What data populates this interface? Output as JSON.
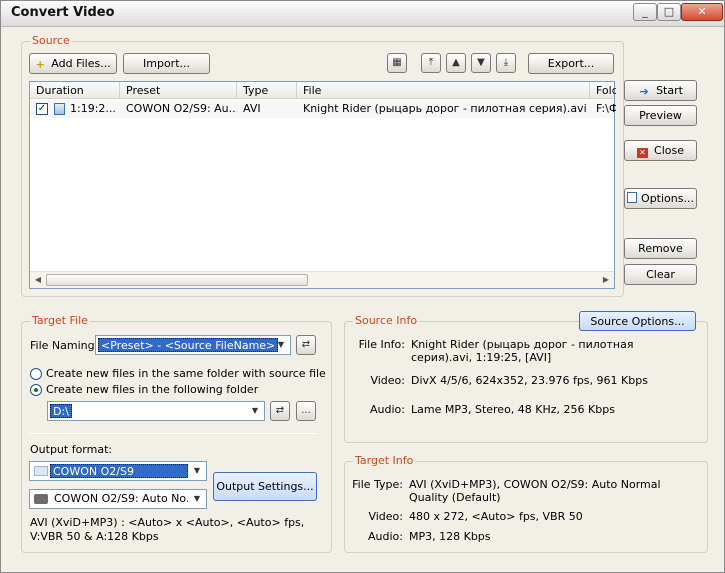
{
  "window": {
    "title": "Convert Video",
    "minimize": "_",
    "maximize": "□",
    "close": "✕"
  },
  "source": {
    "label": "Source",
    "add_files": "Add Files...",
    "import": "Import...",
    "export": "Export...",
    "columns": [
      "Duration",
      "Preset",
      "Type",
      "File",
      "Fold"
    ],
    "rows": [
      {
        "duration": "1:19:2...",
        "preset": "COWON O2/S9: Au...",
        "type": "AVI",
        "file": "Knight Rider (рыцарь дорог - пилотная серия).avi",
        "folder": "F:\\Ф"
      }
    ]
  },
  "side_buttons": {
    "start": "Start",
    "preview": "Preview",
    "close": "Close",
    "options": "Options...",
    "remove": "Remove",
    "clear": "Clear"
  },
  "target_file": {
    "label": "Target File",
    "naming_label": "File Naming:",
    "naming_value": "<Preset> - <Source FileName>",
    "radio_same": "Create new files in the same folder with source file",
    "radio_following": "Create new files in the following folder",
    "folder_value": "D:\\",
    "browse": "...",
    "output_format_label": "Output format:",
    "format_device": "COWON O2/S9",
    "format_preset": "COWON O2/S9: Auto No...",
    "output_settings": "Output Settings...",
    "format_summary": "AVI (XviD+MP3) : <Auto> x <Auto>, <Auto> fps, V:VBR 50 & A:128 Kbps"
  },
  "source_info": {
    "label": "Source Info",
    "options_button": "Source Options...",
    "file_info_key": "File Info:",
    "file_info_val": "Knight Rider (рыцарь дорог - пилотная серия).avi, 1:19:25,  [AVI]",
    "video_key": "Video:",
    "video_val": "DivX 4/5/6, 624x352, 23.976 fps, 961 Kbps",
    "audio_key": "Audio:",
    "audio_val": "Lame MP3, Stereo, 48 KHz, 256 Kbps"
  },
  "target_info": {
    "label": "Target Info",
    "file_type_key": "File Type:",
    "file_type_val": "AVI (XviD+MP3), COWON O2/S9: Auto Normal Quality (Default)",
    "video_key": "Video:",
    "video_val": "480 x 272, <Auto> fps, VBR 50",
    "audio_key": "Audio:",
    "audio_val": "MP3, 128 Kbps"
  },
  "colors": {
    "group_label": "#d0471b",
    "selection": "#316ac5",
    "frame": "#f1efe6"
  }
}
